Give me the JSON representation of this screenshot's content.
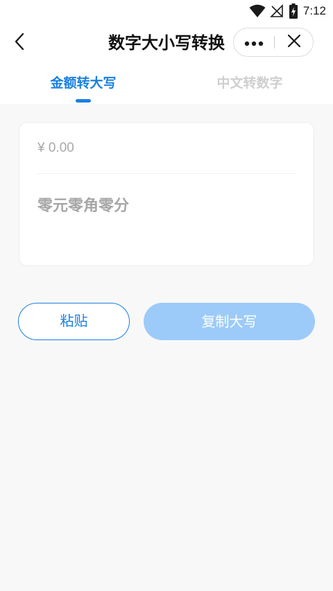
{
  "status_bar": {
    "time": "7:12",
    "icons": [
      "wifi-icon",
      "no-signal-icon",
      "battery-charging-icon"
    ]
  },
  "nav": {
    "title": "数字大小写转换",
    "back_icon": "chevron-left-icon",
    "more_icon": "more-dots-icon",
    "close_icon": "close-icon"
  },
  "tabs": [
    {
      "label": "金额转大写",
      "active": true
    },
    {
      "label": "中文转数字",
      "active": false
    }
  ],
  "card": {
    "amount_placeholder": "¥ 0.00",
    "amount_value": "",
    "result_text": "零元零角零分"
  },
  "buttons": {
    "paste_label": "粘贴",
    "copy_label": "复制大写"
  },
  "colors": {
    "accent": "#1a7fe0",
    "disabled_button": "#9dcbf9",
    "inactive_tab": "#cfcfcf",
    "page_background": "#f8f8f8"
  }
}
